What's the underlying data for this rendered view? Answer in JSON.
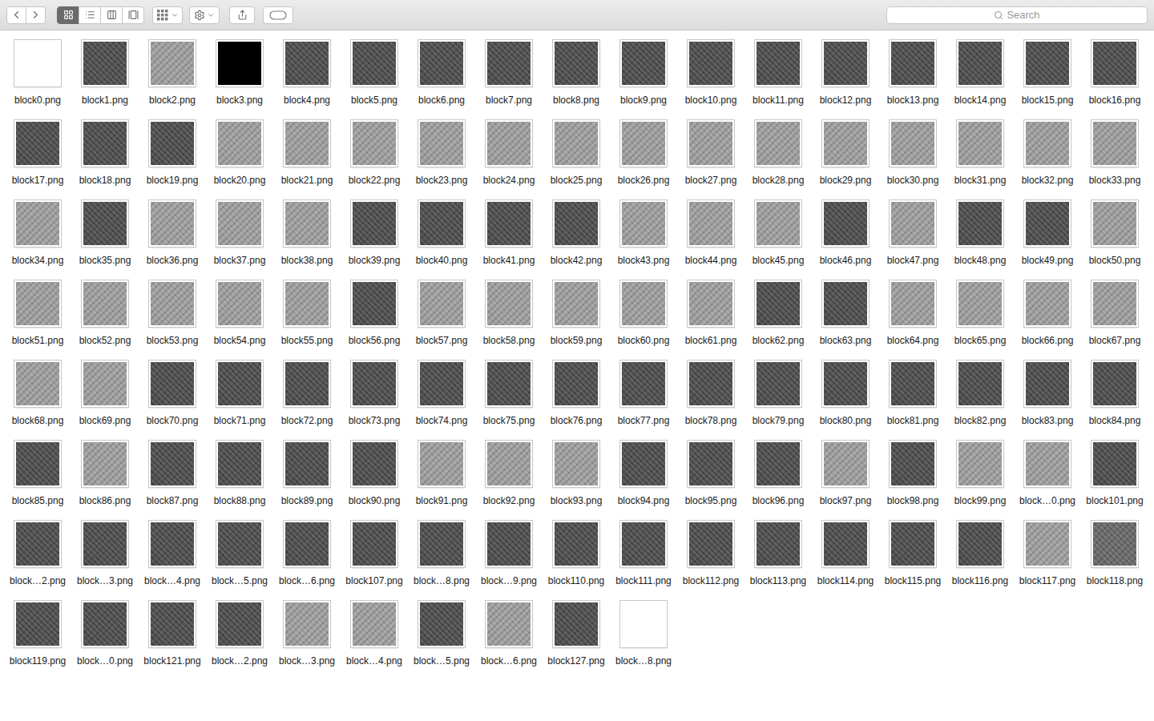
{
  "toolbar": {
    "navigation": [
      {
        "kind": "back"
      },
      {
        "kind": "forward"
      }
    ],
    "view_modes": [
      {
        "kind": "icons",
        "selected": true
      },
      {
        "kind": "list",
        "selected": false
      },
      {
        "kind": "columns",
        "selected": false
      },
      {
        "kind": "gallery",
        "selected": false
      }
    ],
    "buttons": [
      {
        "kind": "group"
      },
      {
        "kind": "action"
      },
      {
        "kind": "share"
      },
      {
        "kind": "tags"
      }
    ]
  },
  "search": {
    "placeholder": "Search"
  },
  "files": [
    {
      "name": "block0.png",
      "color": "#ffffff"
    },
    {
      "name": "block1.png",
      "color": "#4f4f4f"
    },
    {
      "name": "block2.png",
      "color": "#a0a0a0"
    },
    {
      "name": "block3.png",
      "color": "#000000"
    },
    {
      "name": "block4.png",
      "color": "#4f4f4f"
    },
    {
      "name": "block5.png",
      "color": "#4f4f4f"
    },
    {
      "name": "block6.png",
      "color": "#4f4f4f"
    },
    {
      "name": "block7.png",
      "color": "#4f4f4f"
    },
    {
      "name": "block8.png",
      "color": "#4f4f4f"
    },
    {
      "name": "block9.png",
      "color": "#4f4f4f"
    },
    {
      "name": "block10.png",
      "color": "#4f4f4f"
    },
    {
      "name": "block11.png",
      "color": "#4f4f4f"
    },
    {
      "name": "block12.png",
      "color": "#4f4f4f"
    },
    {
      "name": "block13.png",
      "color": "#4f4f4f"
    },
    {
      "name": "block14.png",
      "color": "#4f4f4f"
    },
    {
      "name": "block15.png",
      "color": "#4f4f4f"
    },
    {
      "name": "block16.png",
      "color": "#4f4f4f"
    },
    {
      "name": "block17.png",
      "color": "#4f4f4f"
    },
    {
      "name": "block18.png",
      "color": "#4f4f4f"
    },
    {
      "name": "block19.png",
      "color": "#4f4f4f"
    },
    {
      "name": "block20.png",
      "color": "#a0a0a0"
    },
    {
      "name": "block21.png",
      "color": "#a0a0a0"
    },
    {
      "name": "block22.png",
      "color": "#a0a0a0"
    },
    {
      "name": "block23.png",
      "color": "#a0a0a0"
    },
    {
      "name": "block24.png",
      "color": "#a0a0a0"
    },
    {
      "name": "block25.png",
      "color": "#a0a0a0"
    },
    {
      "name": "block26.png",
      "color": "#a0a0a0"
    },
    {
      "name": "block27.png",
      "color": "#a0a0a0"
    },
    {
      "name": "block28.png",
      "color": "#a0a0a0"
    },
    {
      "name": "block29.png",
      "color": "#a0a0a0"
    },
    {
      "name": "block30.png",
      "color": "#a0a0a0"
    },
    {
      "name": "block31.png",
      "color": "#a0a0a0"
    },
    {
      "name": "block32.png",
      "color": "#a0a0a0"
    },
    {
      "name": "block33.png",
      "color": "#a0a0a0"
    },
    {
      "name": "block34.png",
      "color": "#a0a0a0"
    },
    {
      "name": "block35.png",
      "color": "#4f4f4f"
    },
    {
      "name": "block36.png",
      "color": "#a0a0a0"
    },
    {
      "name": "block37.png",
      "color": "#a0a0a0"
    },
    {
      "name": "block38.png",
      "color": "#a0a0a0"
    },
    {
      "name": "block39.png",
      "color": "#4f4f4f"
    },
    {
      "name": "block40.png",
      "color": "#4f4f4f"
    },
    {
      "name": "block41.png",
      "color": "#4f4f4f"
    },
    {
      "name": "block42.png",
      "color": "#4f4f4f"
    },
    {
      "name": "block43.png",
      "color": "#a0a0a0"
    },
    {
      "name": "block44.png",
      "color": "#a0a0a0"
    },
    {
      "name": "block45.png",
      "color": "#a0a0a0"
    },
    {
      "name": "block46.png",
      "color": "#4f4f4f"
    },
    {
      "name": "block47.png",
      "color": "#a0a0a0"
    },
    {
      "name": "block48.png",
      "color": "#4f4f4f"
    },
    {
      "name": "block49.png",
      "color": "#4f4f4f"
    },
    {
      "name": "block50.png",
      "color": "#a0a0a0"
    },
    {
      "name": "block51.png",
      "color": "#a0a0a0"
    },
    {
      "name": "block52.png",
      "color": "#a0a0a0"
    },
    {
      "name": "block53.png",
      "color": "#a0a0a0"
    },
    {
      "name": "block54.png",
      "color": "#a0a0a0"
    },
    {
      "name": "block55.png",
      "color": "#a0a0a0"
    },
    {
      "name": "block56.png",
      "color": "#4f4f4f"
    },
    {
      "name": "block57.png",
      "color": "#a0a0a0"
    },
    {
      "name": "block58.png",
      "color": "#a0a0a0"
    },
    {
      "name": "block59.png",
      "color": "#a0a0a0"
    },
    {
      "name": "block60.png",
      "color": "#a0a0a0"
    },
    {
      "name": "block61.png",
      "color": "#a0a0a0"
    },
    {
      "name": "block62.png",
      "color": "#4f4f4f"
    },
    {
      "name": "block63.png",
      "color": "#4f4f4f"
    },
    {
      "name": "block64.png",
      "color": "#a0a0a0"
    },
    {
      "name": "block65.png",
      "color": "#a0a0a0"
    },
    {
      "name": "block66.png",
      "color": "#a0a0a0"
    },
    {
      "name": "block67.png",
      "color": "#a0a0a0"
    },
    {
      "name": "block68.png",
      "color": "#a0a0a0"
    },
    {
      "name": "block69.png",
      "color": "#a0a0a0"
    },
    {
      "name": "block70.png",
      "color": "#4f4f4f"
    },
    {
      "name": "block71.png",
      "color": "#4f4f4f"
    },
    {
      "name": "block72.png",
      "color": "#4f4f4f"
    },
    {
      "name": "block73.png",
      "color": "#4f4f4f"
    },
    {
      "name": "block74.png",
      "color": "#4f4f4f"
    },
    {
      "name": "block75.png",
      "color": "#4f4f4f"
    },
    {
      "name": "block76.png",
      "color": "#4f4f4f"
    },
    {
      "name": "block77.png",
      "color": "#4f4f4f"
    },
    {
      "name": "block78.png",
      "color": "#4f4f4f"
    },
    {
      "name": "block79.png",
      "color": "#4f4f4f"
    },
    {
      "name": "block80.png",
      "color": "#4f4f4f"
    },
    {
      "name": "block81.png",
      "color": "#4f4f4f"
    },
    {
      "name": "block82.png",
      "color": "#4f4f4f"
    },
    {
      "name": "block83.png",
      "color": "#4f4f4f"
    },
    {
      "name": "block84.png",
      "color": "#4f4f4f"
    },
    {
      "name": "block85.png",
      "color": "#4f4f4f"
    },
    {
      "name": "block86.png",
      "color": "#a0a0a0"
    },
    {
      "name": "block87.png",
      "color": "#4f4f4f"
    },
    {
      "name": "block88.png",
      "color": "#4f4f4f"
    },
    {
      "name": "block89.png",
      "color": "#4f4f4f"
    },
    {
      "name": "block90.png",
      "color": "#4f4f4f"
    },
    {
      "name": "block91.png",
      "color": "#a0a0a0"
    },
    {
      "name": "block92.png",
      "color": "#a0a0a0"
    },
    {
      "name": "block93.png",
      "color": "#a0a0a0"
    },
    {
      "name": "block94.png",
      "color": "#4f4f4f"
    },
    {
      "name": "block95.png",
      "color": "#4f4f4f"
    },
    {
      "name": "block96.png",
      "color": "#4f4f4f"
    },
    {
      "name": "block97.png",
      "color": "#a0a0a0"
    },
    {
      "name": "block98.png",
      "color": "#4f4f4f"
    },
    {
      "name": "block99.png",
      "color": "#a0a0a0"
    },
    {
      "name": "block…0.png",
      "color": "#a0a0a0"
    },
    {
      "name": "block101.png",
      "color": "#4f4f4f"
    },
    {
      "name": "block…2.png",
      "color": "#4f4f4f"
    },
    {
      "name": "block…3.png",
      "color": "#4f4f4f"
    },
    {
      "name": "block…4.png",
      "color": "#4f4f4f"
    },
    {
      "name": "block…5.png",
      "color": "#4f4f4f"
    },
    {
      "name": "block…6.png",
      "color": "#4f4f4f"
    },
    {
      "name": "block107.png",
      "color": "#4f4f4f"
    },
    {
      "name": "block…8.png",
      "color": "#4f4f4f"
    },
    {
      "name": "block…9.png",
      "color": "#4f4f4f"
    },
    {
      "name": "block110.png",
      "color": "#4f4f4f"
    },
    {
      "name": "block111.png",
      "color": "#4f4f4f"
    },
    {
      "name": "block112.png",
      "color": "#4f4f4f"
    },
    {
      "name": "block113.png",
      "color": "#4f4f4f"
    },
    {
      "name": "block114.png",
      "color": "#4f4f4f"
    },
    {
      "name": "block115.png",
      "color": "#4f4f4f"
    },
    {
      "name": "block116.png",
      "color": "#4f4f4f"
    },
    {
      "name": "block117.png",
      "color": "#a0a0a0"
    },
    {
      "name": "block118.png",
      "color": "#6a6a6a"
    },
    {
      "name": "block119.png",
      "color": "#4f4f4f"
    },
    {
      "name": "block…0.png",
      "color": "#4f4f4f"
    },
    {
      "name": "block121.png",
      "color": "#4f4f4f"
    },
    {
      "name": "block…2.png",
      "color": "#4f4f4f"
    },
    {
      "name": "block…3.png",
      "color": "#a0a0a0"
    },
    {
      "name": "block…4.png",
      "color": "#a0a0a0"
    },
    {
      "name": "block…5.png",
      "color": "#4f4f4f"
    },
    {
      "name": "block…6.png",
      "color": "#a0a0a0"
    },
    {
      "name": "block127.png",
      "color": "#4f4f4f"
    },
    {
      "name": "block…8.png",
      "color": "#ffffff"
    }
  ]
}
